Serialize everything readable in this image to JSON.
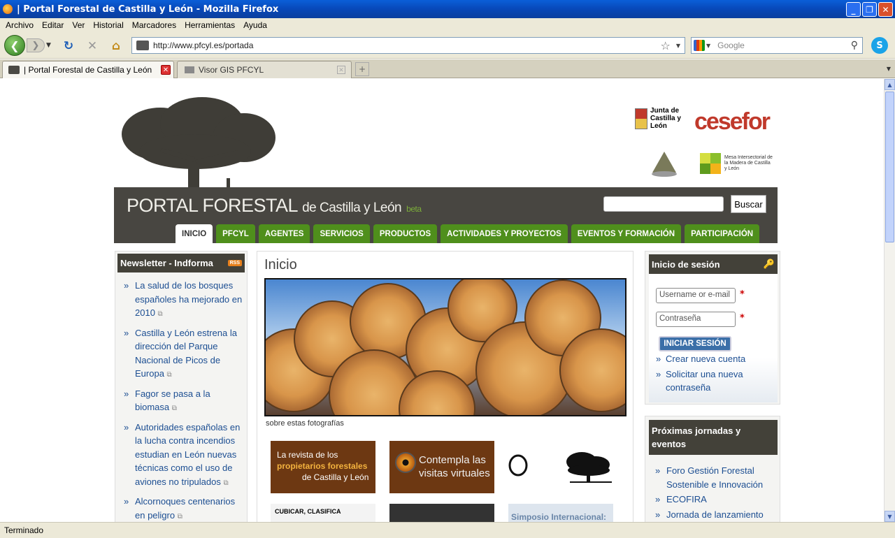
{
  "window": {
    "title": "| Portal Forestal de Castilla y León - Mozilla Firefox"
  },
  "menu": [
    "Archivo",
    "Editar",
    "Ver",
    "Historial",
    "Marcadores",
    "Herramientas",
    "Ayuda"
  ],
  "nav": {
    "url": "http://www.pfcyl.es/portada",
    "search_placeholder": "Google"
  },
  "tabs": [
    {
      "label": "| Portal Forestal de Castilla y León",
      "active": true
    },
    {
      "label": "Visor GIS PFCYL",
      "active": false
    }
  ],
  "status": "Terminado",
  "site": {
    "name": "PORTAL FORESTAL",
    "name_sub": "de Castilla y León",
    "beta": "beta",
    "search_button": "Buscar",
    "logos": {
      "junta": "Junta de Castilla y León",
      "cesefor": "cesefor",
      "mesa": "Mesa Intersectorial de la Madera de Castilla y León"
    },
    "navtabs": [
      "INICIO",
      "PFCYL",
      "AGENTES",
      "SERVICIOS",
      "PRODUCTOS",
      "ACTIVIDADES Y PROYECTOS",
      "EVENTOS Y FORMACIÓN",
      "PARTICIPACIÓN"
    ]
  },
  "left": {
    "title": "Newsletter - Indforma",
    "rss": "RSS",
    "items": [
      "La salud de los bosques españoles ha mejorado en 2010",
      "Castilla y León estrena la dirección del Parque Nacional de Picos de Europa",
      "Fagor se pasa a la biomasa",
      "Autoridades españolas en la lucha contra incendios estudian en León nuevas técnicas como el uso de aviones no tripulados",
      "Alcornoques centenarios en peligro"
    ]
  },
  "main": {
    "title": "Inicio",
    "caption": "sobre estas fotografías",
    "banner1": {
      "line1": "La revista de los",
      "line2": "propietarios forestales",
      "line3": "de Castilla y León"
    },
    "banner2": {
      "text": "Contempla las visitas virtuales"
    },
    "banner4": {
      "text": "CUBICAR, CLASIFICA"
    },
    "banner6": {
      "text": "Simposio Internacional:"
    }
  },
  "login": {
    "title": "Inicio de sesión",
    "username_placeholder": "Username or e-mail",
    "password_placeholder": "Contraseña",
    "required": "*",
    "submit": "INICIAR SESIÓN",
    "links": [
      "Crear nueva cuenta",
      "Solicitar una nueva contraseña"
    ]
  },
  "events": {
    "title": "Próximas jornadas y eventos",
    "items": [
      "Foro Gestión Forestal Sostenible e Innovación",
      "ECOFIRA",
      "Jornada de lanzamiento"
    ]
  }
}
